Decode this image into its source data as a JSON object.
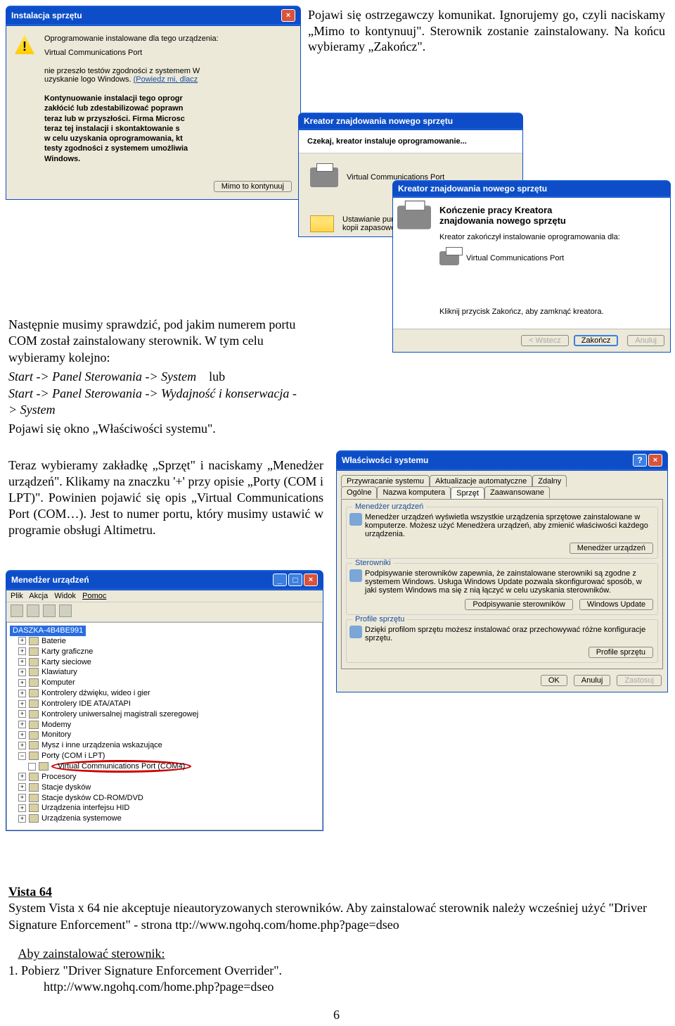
{
  "para1": "Pojawi się ostrzegawczy komunikat. Ignorujemy go, czyli naciskamy „Mimo to kontynuuj\". Sterownik zostanie zainstalowany. Na końcu wybieramy „Zakończ\".",
  "para2a": "Następnie musimy sprawdzić, pod jakim numerem portu COM został zainstalowany sterownik. W tym celu wybieramy kolejno:",
  "navA": "Start -> Panel Sterowania -> System",
  "navLub": "lub",
  "navB": "Start -> Panel Sterowania -> Wydajność i konserwacja -> System",
  "para2b": "Pojawi się okno „Właściwości systemu\".",
  "para3": "Teraz wybieramy zakładkę „Sprzęt\" i naciskamy „Menedżer urządzeń\". Klikamy na znaczku '+' przy opisie „Porty (COM i LPT)\". Powinien pojawić się opis „Virtual Communications Port (COM…). Jest to numer portu, który musimy ustawić w programie obsługi Altimetru.",
  "inst": {
    "title": "Instalacja sprzętu",
    "h": "Oprogramowanie instalowane dla tego urządzenia:",
    "dev": "Virtual Communications Port",
    "l1": "nie przeszło testów zgodności z systemem W",
    "l2": "uzyskanie logo Windows.",
    "l2b": "(Powiedz mi, dlacz",
    "p1": "Kontynuowanie instalacji tego oprogr",
    "p2": "zakłócić lub zdestabilizować poprawn",
    "p3": "teraz lub w przyszłości. Firma Microsc",
    "p4": "teraz tej instalacji i skontaktowanie s",
    "p5": "w celu uzyskania oprogramowania, kt",
    "p6": "testy zgodności z systemem umożliwia",
    "p7": "Windows.",
    "btn": "Mimo to kontynuuj"
  },
  "wiz1": {
    "title": "Kreator znajdowania nowego sprzętu",
    "sub": "Czekaj, kreator instaluje oprogramowanie...",
    "dev": "Virtual Communications Port",
    "foot": "Ustawianie punktu przywra",
    "foot2": "kopii zapasowej starych plik"
  },
  "wiz2": {
    "title": "Kreator znajdowania nowego sprzętu",
    "h1": "Kończenie pracy Kreatora",
    "h2": "znajdowania nowego sprzętu",
    "l1": "Kreator zakończył instalowanie oprogramowania dla:",
    "dev": "Virtual Communications Port",
    "close": "Kliknij przycisk Zakończ, aby zamknąć kreatora.",
    "b1": "< Wstecz",
    "b2": "Zakończ",
    "b3": "Anuluj"
  },
  "dm": {
    "title": "Menedżer urządzeń",
    "menu": [
      "Plik",
      "Akcja",
      "Widok",
      "Pomoc"
    ],
    "root": "DASZKA-4B4BE991",
    "items": [
      "Baterie",
      "Karty graficzne",
      "Karty sieciowe",
      "Klawiatury",
      "Komputer",
      "Kontrolery dźwięku, wideo i gier",
      "Kontrolery IDE ATA/ATAPI",
      "Kontrolery uniwersalnej magistrali szeregowej",
      "Modemy",
      "Monitory",
      "Mysz i inne urządzenia wskazujące",
      "Porty (COM i LPT)"
    ],
    "vcp": "Virtual Communications Port (COM4)",
    "items2": [
      "Procesory",
      "Stacje dysków",
      "Stacje dysków CD-ROM/DVD",
      "Urządzenia interfejsu HID",
      "Urządzenia systemowe"
    ]
  },
  "sp": {
    "title": "Właściwości systemu",
    "tabs": [
      "Przywracanie systemu",
      "Aktualizacje automatyczne",
      "Zdalny",
      "Ogólne",
      "Nazwa komputera",
      "Sprzęt",
      "Zaawansowane"
    ],
    "g1": {
      "lbl": "Menedżer urządzeń",
      "txt": "Menedżer urządzeń wyświetla wszystkie urządzenia sprzętowe zainstalowane w komputerze. Możesz użyć Menedżera urządzeń, aby zmienić właściwości każdego urządzenia.",
      "btn": "Menedżer urządzeń"
    },
    "g2": {
      "lbl": "Sterowniki",
      "txt": "Podpisywanie sterowników zapewnia, że zainstalowane sterowniki są zgodne z systemem Windows. Usługa Windows Update pozwala skonfigurować sposób, w jaki system Windows ma się z nią łączyć w celu uzyskania sterowników.",
      "b1": "Podpisywanie sterowników",
      "b2": "Windows Update"
    },
    "g3": {
      "lbl": "Profile sprzętu",
      "txt": "Dzięki profilom sprzętu możesz instalować oraz przechowywać różne konfiguracje sprzętu.",
      "btn": "Profile sprzętu"
    },
    "ok": "OK",
    "cancel": "Anuluj",
    "apply": "Zastosuj"
  },
  "vista": {
    "h": "Vista 64",
    "p1": "System Vista x 64 nie akceptuje nieautoryzowanych sterowników. Aby zainstalować sterownik należy wcześniej użyć \"Driver Signature Enforcement\" - strona  ttp://www.ngohq.com/home.php?page=dseo",
    "h2": "Aby zainstalować sterownik:",
    "s1": "1. Pobierz \"Driver Signature Enforcement Overrider\".",
    "s1u": "http://www.ngohq.com/home.php?page=dseo"
  },
  "pg": "6"
}
